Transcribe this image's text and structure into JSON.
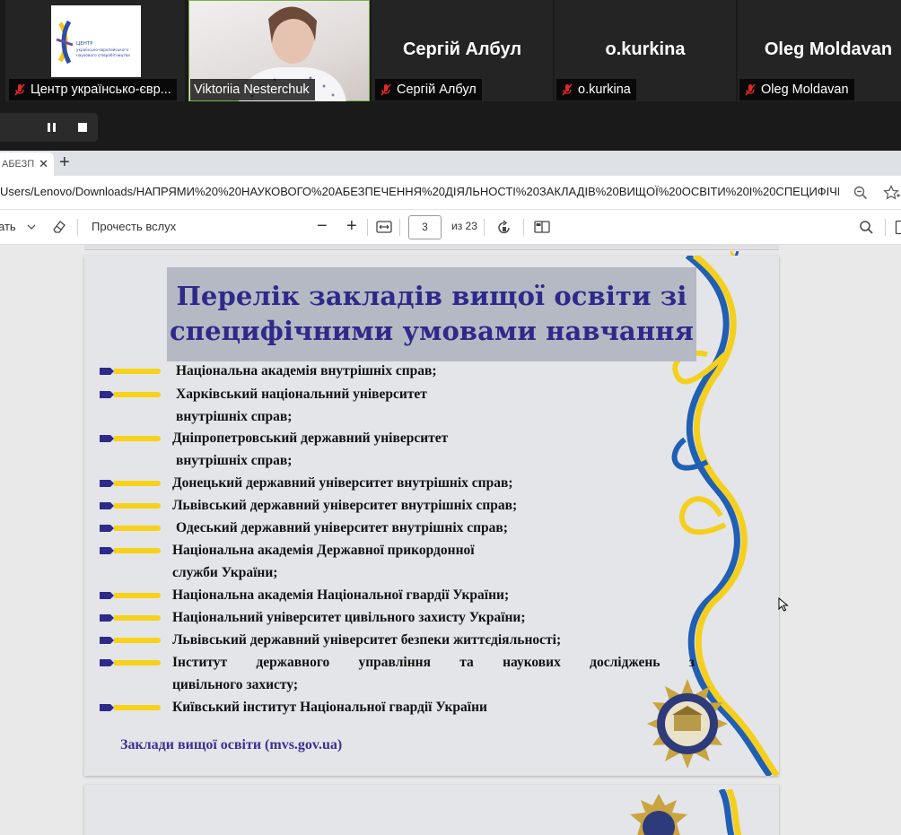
{
  "call": {
    "participants": [
      {
        "label": "Центр українсько-євр..."
      },
      {
        "label": "Viktoriia Nesterchuk"
      },
      {
        "label": "Сергій Албул",
        "display_name": "Сергій Албул"
      },
      {
        "label": "o.kurkina",
        "display_name": "o.kurkina"
      },
      {
        "label": "Oleg Moldavan",
        "display_name": "Oleg Moldavan"
      }
    ],
    "logo_text": [
      "ЦЕНТР",
      "українсько-європейського",
      "наукового співробітництва"
    ]
  },
  "browser": {
    "tab_title": "АБЕЗП",
    "url": "Users/Lenovo/Downloads/НАПРЯМИ%20%20НАУКОВОГО%20АБЕЗПЕЧЕННЯ%20ДІЯЛЬНОСТІ%20ЗАКЛАДІВ%20ВИЩОЇ%20ОСВІТИ%20І%20СПЕЦИФІЧН..."
  },
  "pdf_toolbar": {
    "left_partial": "ать",
    "read_aloud": "Прочесть вслух",
    "page_current": "3",
    "page_total": "из 23"
  },
  "slide": {
    "title_line1": "Перелік закладів вищої освіти зі",
    "title_line2": "специфічними умовами навчання",
    "items": [
      [
        "Національна академія внутрішніх справ;"
      ],
      [
        "Харківський національний університет",
        "внутрішніх справ;"
      ],
      [
        "Дніпропетровський державний університет",
        "внутрішніх справ;"
      ],
      [
        "Донецький державний університет внутрішніх справ;"
      ],
      [
        "Львівський державний університет внутрішніх справ;"
      ],
      [
        "Одеський державний університет внутрішніх справ;"
      ],
      [
        "Національна академія Державної прикордонної",
        "служби України;"
      ],
      [
        "Національна академія Національної гвардії України;"
      ],
      [
        "Національний університет цивільного захисту України;"
      ],
      [
        "Львівський державний університет безпеки життєдіяльності;"
      ],
      [
        "Інститут державного управління та наукових досліджень з",
        "цивільного захисту;"
      ],
      [
        "Київський інститут Національної гвардії України"
      ]
    ],
    "footer": "Заклади вищої освіти (mvs.gov.ua)"
  },
  "colors": {
    "title": "#2e2a8a",
    "bullet_blue": "#2e2a8a",
    "bullet_yellow": "#f6d21a",
    "ribbon_blue": "#1f5fb4",
    "ribbon_yellow": "#f5cf1d",
    "mic_muted": "#e02828"
  }
}
